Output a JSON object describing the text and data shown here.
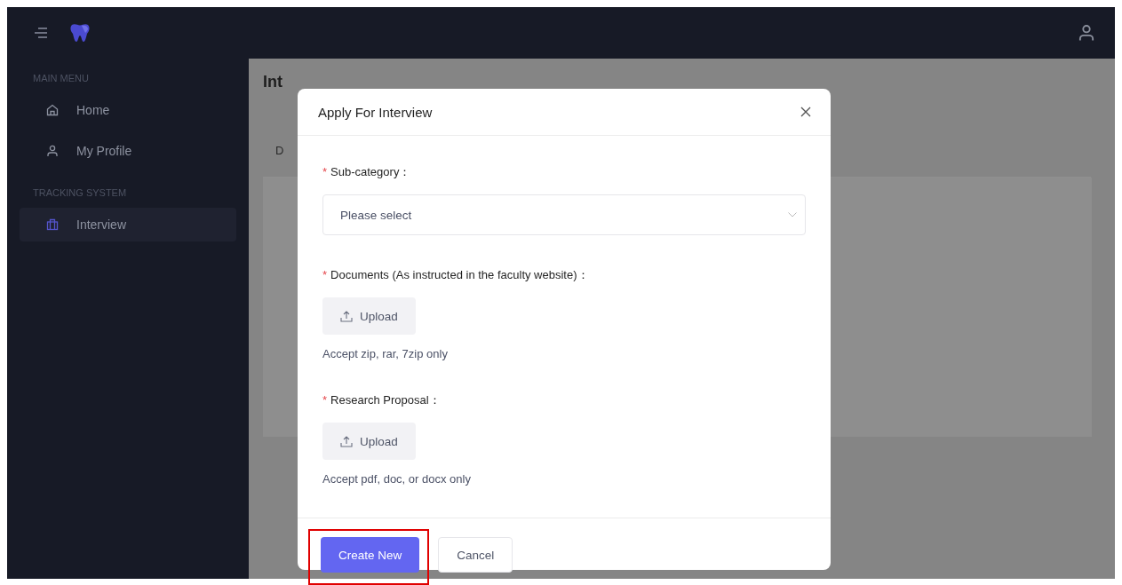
{
  "sidebar": {
    "sections": [
      {
        "title": "MAIN MENU",
        "items": [
          {
            "label": "Home",
            "kind": "home",
            "selected": false
          },
          {
            "label": "My Profile",
            "kind": "profile",
            "selected": false
          }
        ]
      },
      {
        "title": "TRACKING SYSTEM",
        "items": [
          {
            "label": "Interview",
            "kind": "case",
            "selected": true
          }
        ]
      }
    ]
  },
  "page": {
    "title": "Int",
    "tab": "D"
  },
  "modal": {
    "title": "Apply For Interview",
    "fields": [
      {
        "kind": "select",
        "mark": "*",
        "label": "Sub-category：",
        "placeholder": "Please select"
      },
      {
        "kind": "upload",
        "mark": "*",
        "label": "Documents (As instructed in the faculty website)：",
        "button": "Upload",
        "hint": "Accept zip, rar, 7zip only"
      },
      {
        "kind": "upload",
        "mark": "*",
        "label": "Research Proposal：",
        "button": "Upload",
        "hint": "Accept pdf, doc, or docx only"
      }
    ],
    "buttons": [
      {
        "label": "Create New",
        "kind": "primary",
        "highlighted": true
      },
      {
        "label": "Cancel",
        "kind": "default",
        "highlighted": false
      }
    ]
  }
}
